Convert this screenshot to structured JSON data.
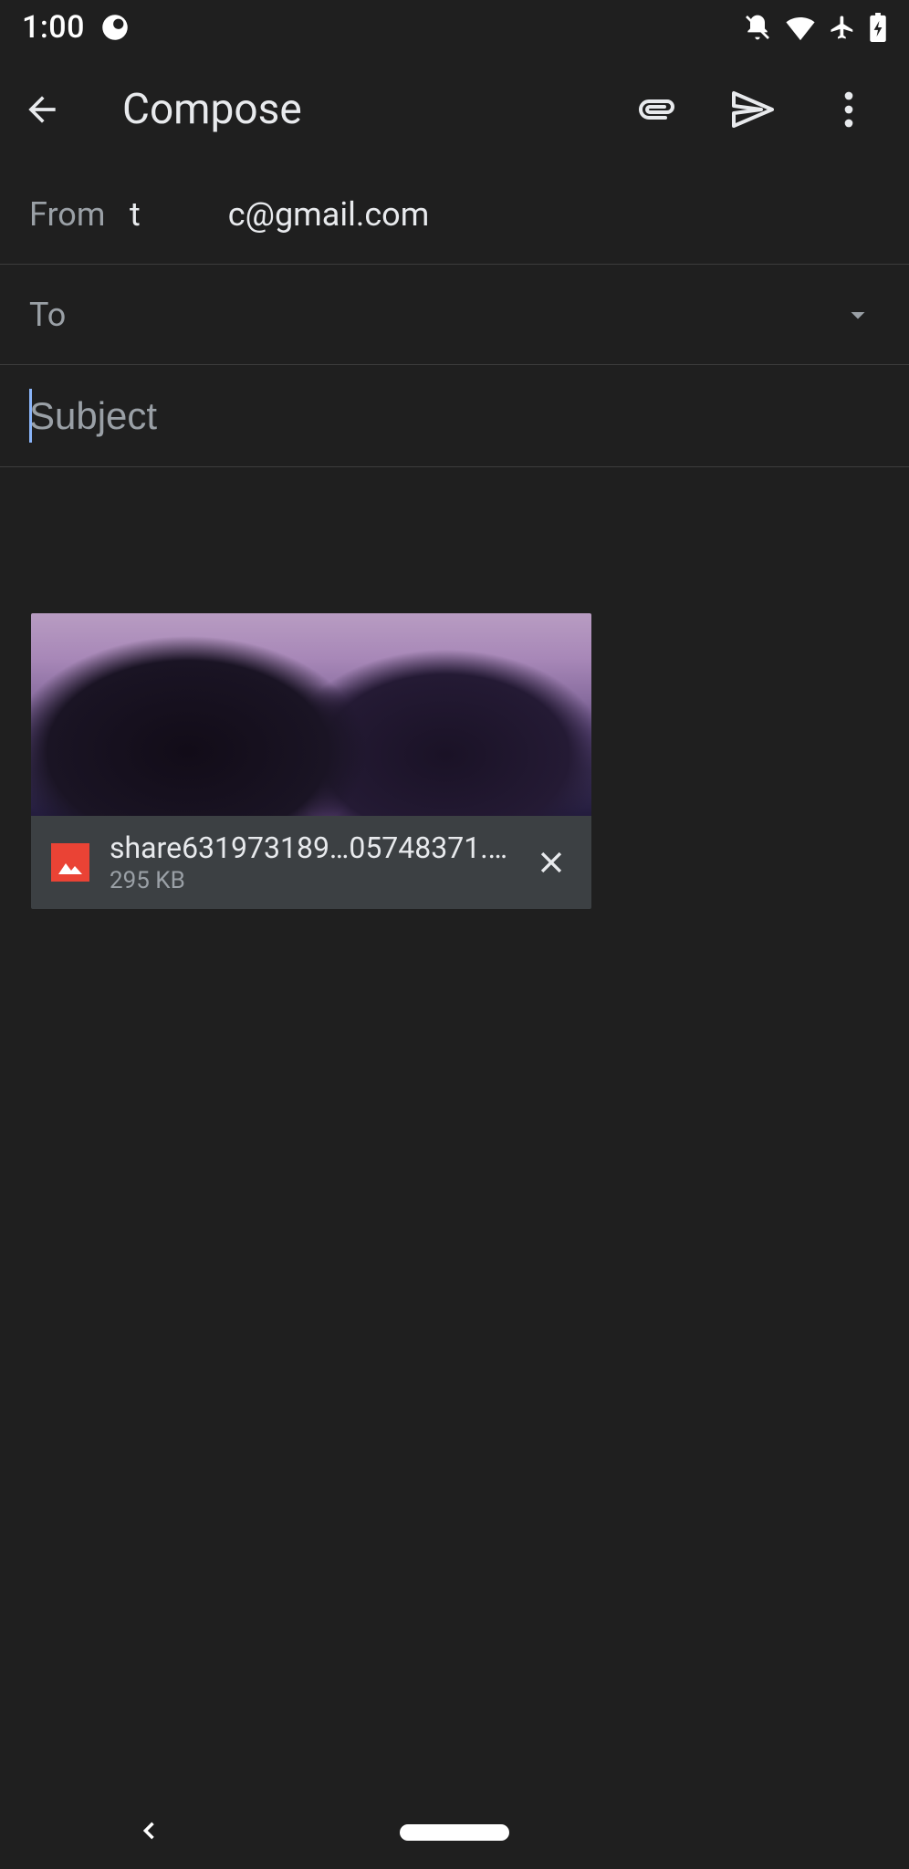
{
  "status": {
    "time": "1:00"
  },
  "appbar": {
    "title": "Compose"
  },
  "compose": {
    "from_label": "From",
    "from_name": "t",
    "from_email": "c@gmail.com",
    "to_label": "To",
    "to_value": "",
    "subject_placeholder": "Subject",
    "subject_value": ""
  },
  "attachment": {
    "filename": "share631973189…05748371.png",
    "filesize": "295 KB"
  }
}
